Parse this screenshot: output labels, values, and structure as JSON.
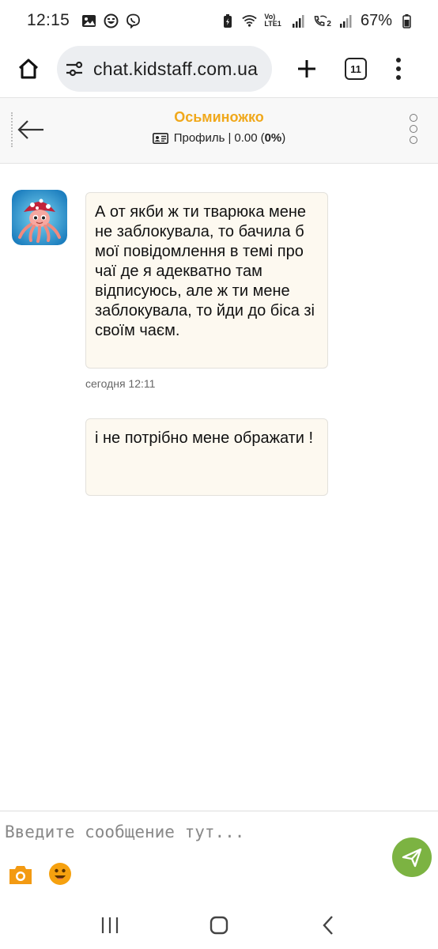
{
  "status_bar": {
    "time": "12:15",
    "network_label": "Vo) LTE1",
    "sim2_label": "2",
    "battery_percent": "67%"
  },
  "browser": {
    "url": "chat.kidstaff.com.ua",
    "tab_count": "11"
  },
  "chat_header": {
    "title": "Осьминожко",
    "profile_label": "Профиль",
    "separator": "|",
    "balance": "0.00",
    "percent_open": "(",
    "percent": "0%",
    "percent_close": ")"
  },
  "messages": [
    {
      "text": "А от якби ж ти тварюка мене не заблокувала, то бачила б мої повідомлення в темі про чаї де я адекватно там відписуюсь, але ж ти мене заблокувала, то йди до біса зі своїм чаєм.",
      "time": "сегодня 12:11"
    },
    {
      "text": "і не потрібно мене ображати !"
    }
  ],
  "composer": {
    "placeholder": "Введите сообщение тут..."
  },
  "icons": {
    "home": "home-icon",
    "site_settings": "tune-icon",
    "add_tab": "plus-icon",
    "menu": "more-vert-icon",
    "back": "arrow-left-icon",
    "profile": "id-card-icon",
    "header_more": "more-vert-circles-icon",
    "camera": "camera-icon",
    "emoji": "emoji-icon",
    "send": "send-icon"
  },
  "colors": {
    "title": "#f0a81b",
    "bubble_bg": "#fdf9f0",
    "send_button": "#7cb342",
    "icon_orange": "#f39a12"
  }
}
